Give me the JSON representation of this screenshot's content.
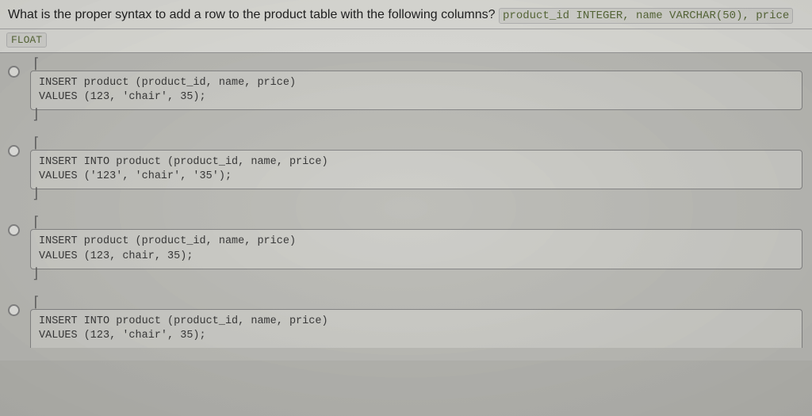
{
  "question": {
    "prompt_lead": "What is the proper syntax to add a row to the product table with the following columns?",
    "columns_code": "product_id INTEGER, name VARCHAR(50), price",
    "trailing_type": "FLOAT"
  },
  "options": [
    {
      "id": "opt-a",
      "code": "INSERT product (product_id, name, price)\nVALUES (123, 'chair', 35);"
    },
    {
      "id": "opt-b",
      "code": "INSERT INTO product (product_id, name, price)\nVALUES ('123', 'chair', '35');"
    },
    {
      "id": "opt-c",
      "code": "INSERT product (product_id, name, price)\nVALUES (123, chair, 35);"
    },
    {
      "id": "opt-d",
      "code": "INSERT INTO product (product_id, name, price)\nVALUES (123, 'chair', 35);"
    }
  ],
  "brackets": {
    "open": "⌈",
    "close": "⌋"
  }
}
